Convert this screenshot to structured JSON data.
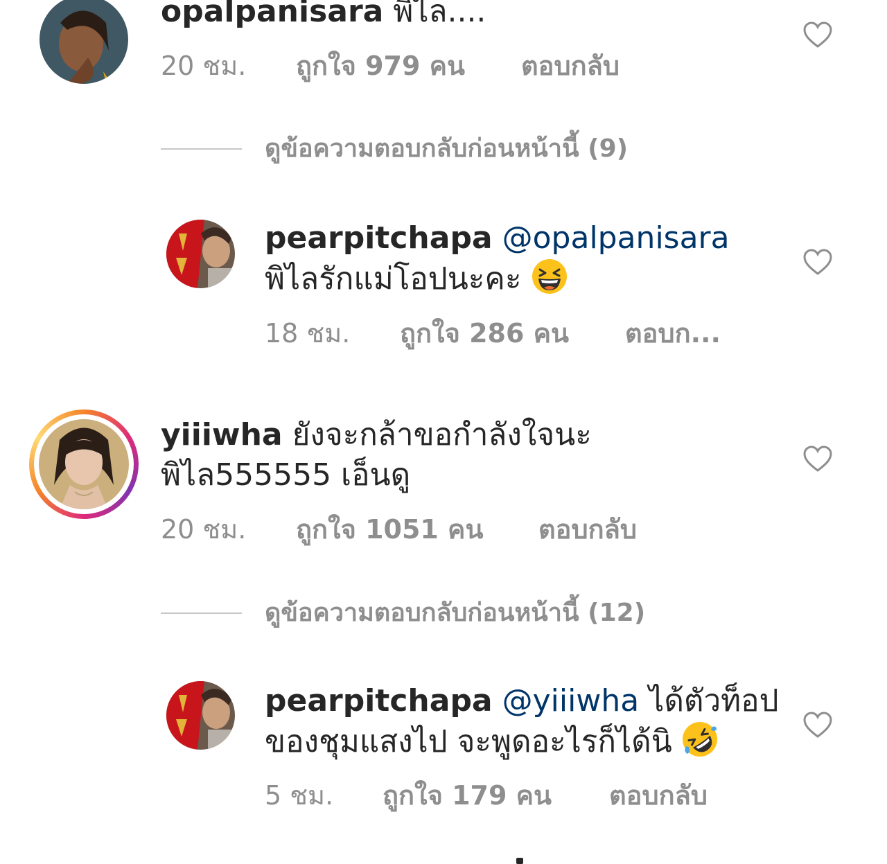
{
  "comments": [
    {
      "username": "opalpanisara",
      "text": "พิไล....",
      "time": "20 ชม.",
      "likes": "ถูกใจ 979 คน",
      "reply": "ตอบกลับ"
    },
    {
      "view_replies": "ดูข้อความตอบกลับก่อนหน้านี้ (9)"
    },
    {
      "username": "pearpitchapa",
      "mention": "@opalpanisara",
      "text_line2": "พิไลรักแม่โอปนะคะ",
      "emoji": "laughing-face",
      "time": "18 ชม.",
      "likes": "ถูกใจ 286 คน",
      "reply": "ตอบก..."
    },
    {
      "username": "yiiiwha",
      "text": "ยังจะกล้าขอกำลังใจนะ",
      "text_line2": "พิไล555555 เอ็นดู",
      "time": "20 ชม.",
      "likes": "ถูกใจ 1051 คน",
      "reply": "ตอบกลับ"
    },
    {
      "view_replies": "ดูข้อความตอบกลับก่อนหน้านี้ (12)"
    },
    {
      "username": "pearpitchapa",
      "mention": "@yiiiwha",
      "text": "ได้ตัวท็อป",
      "text_line2": "ของชุมแสงไป จะพูดอะไรก็ได้นิ",
      "emoji": "rolling-on-floor-laughing",
      "time": "5 ชม.",
      "likes": "ถูกใจ 179 คน",
      "reply": "ตอบกลับ"
    }
  ],
  "colors": {
    "text": "#262626",
    "meta": "#8e8e8e",
    "mention": "#003569",
    "divider": "#c7c7c7"
  },
  "icons": {
    "like": "heart-outline-icon"
  }
}
